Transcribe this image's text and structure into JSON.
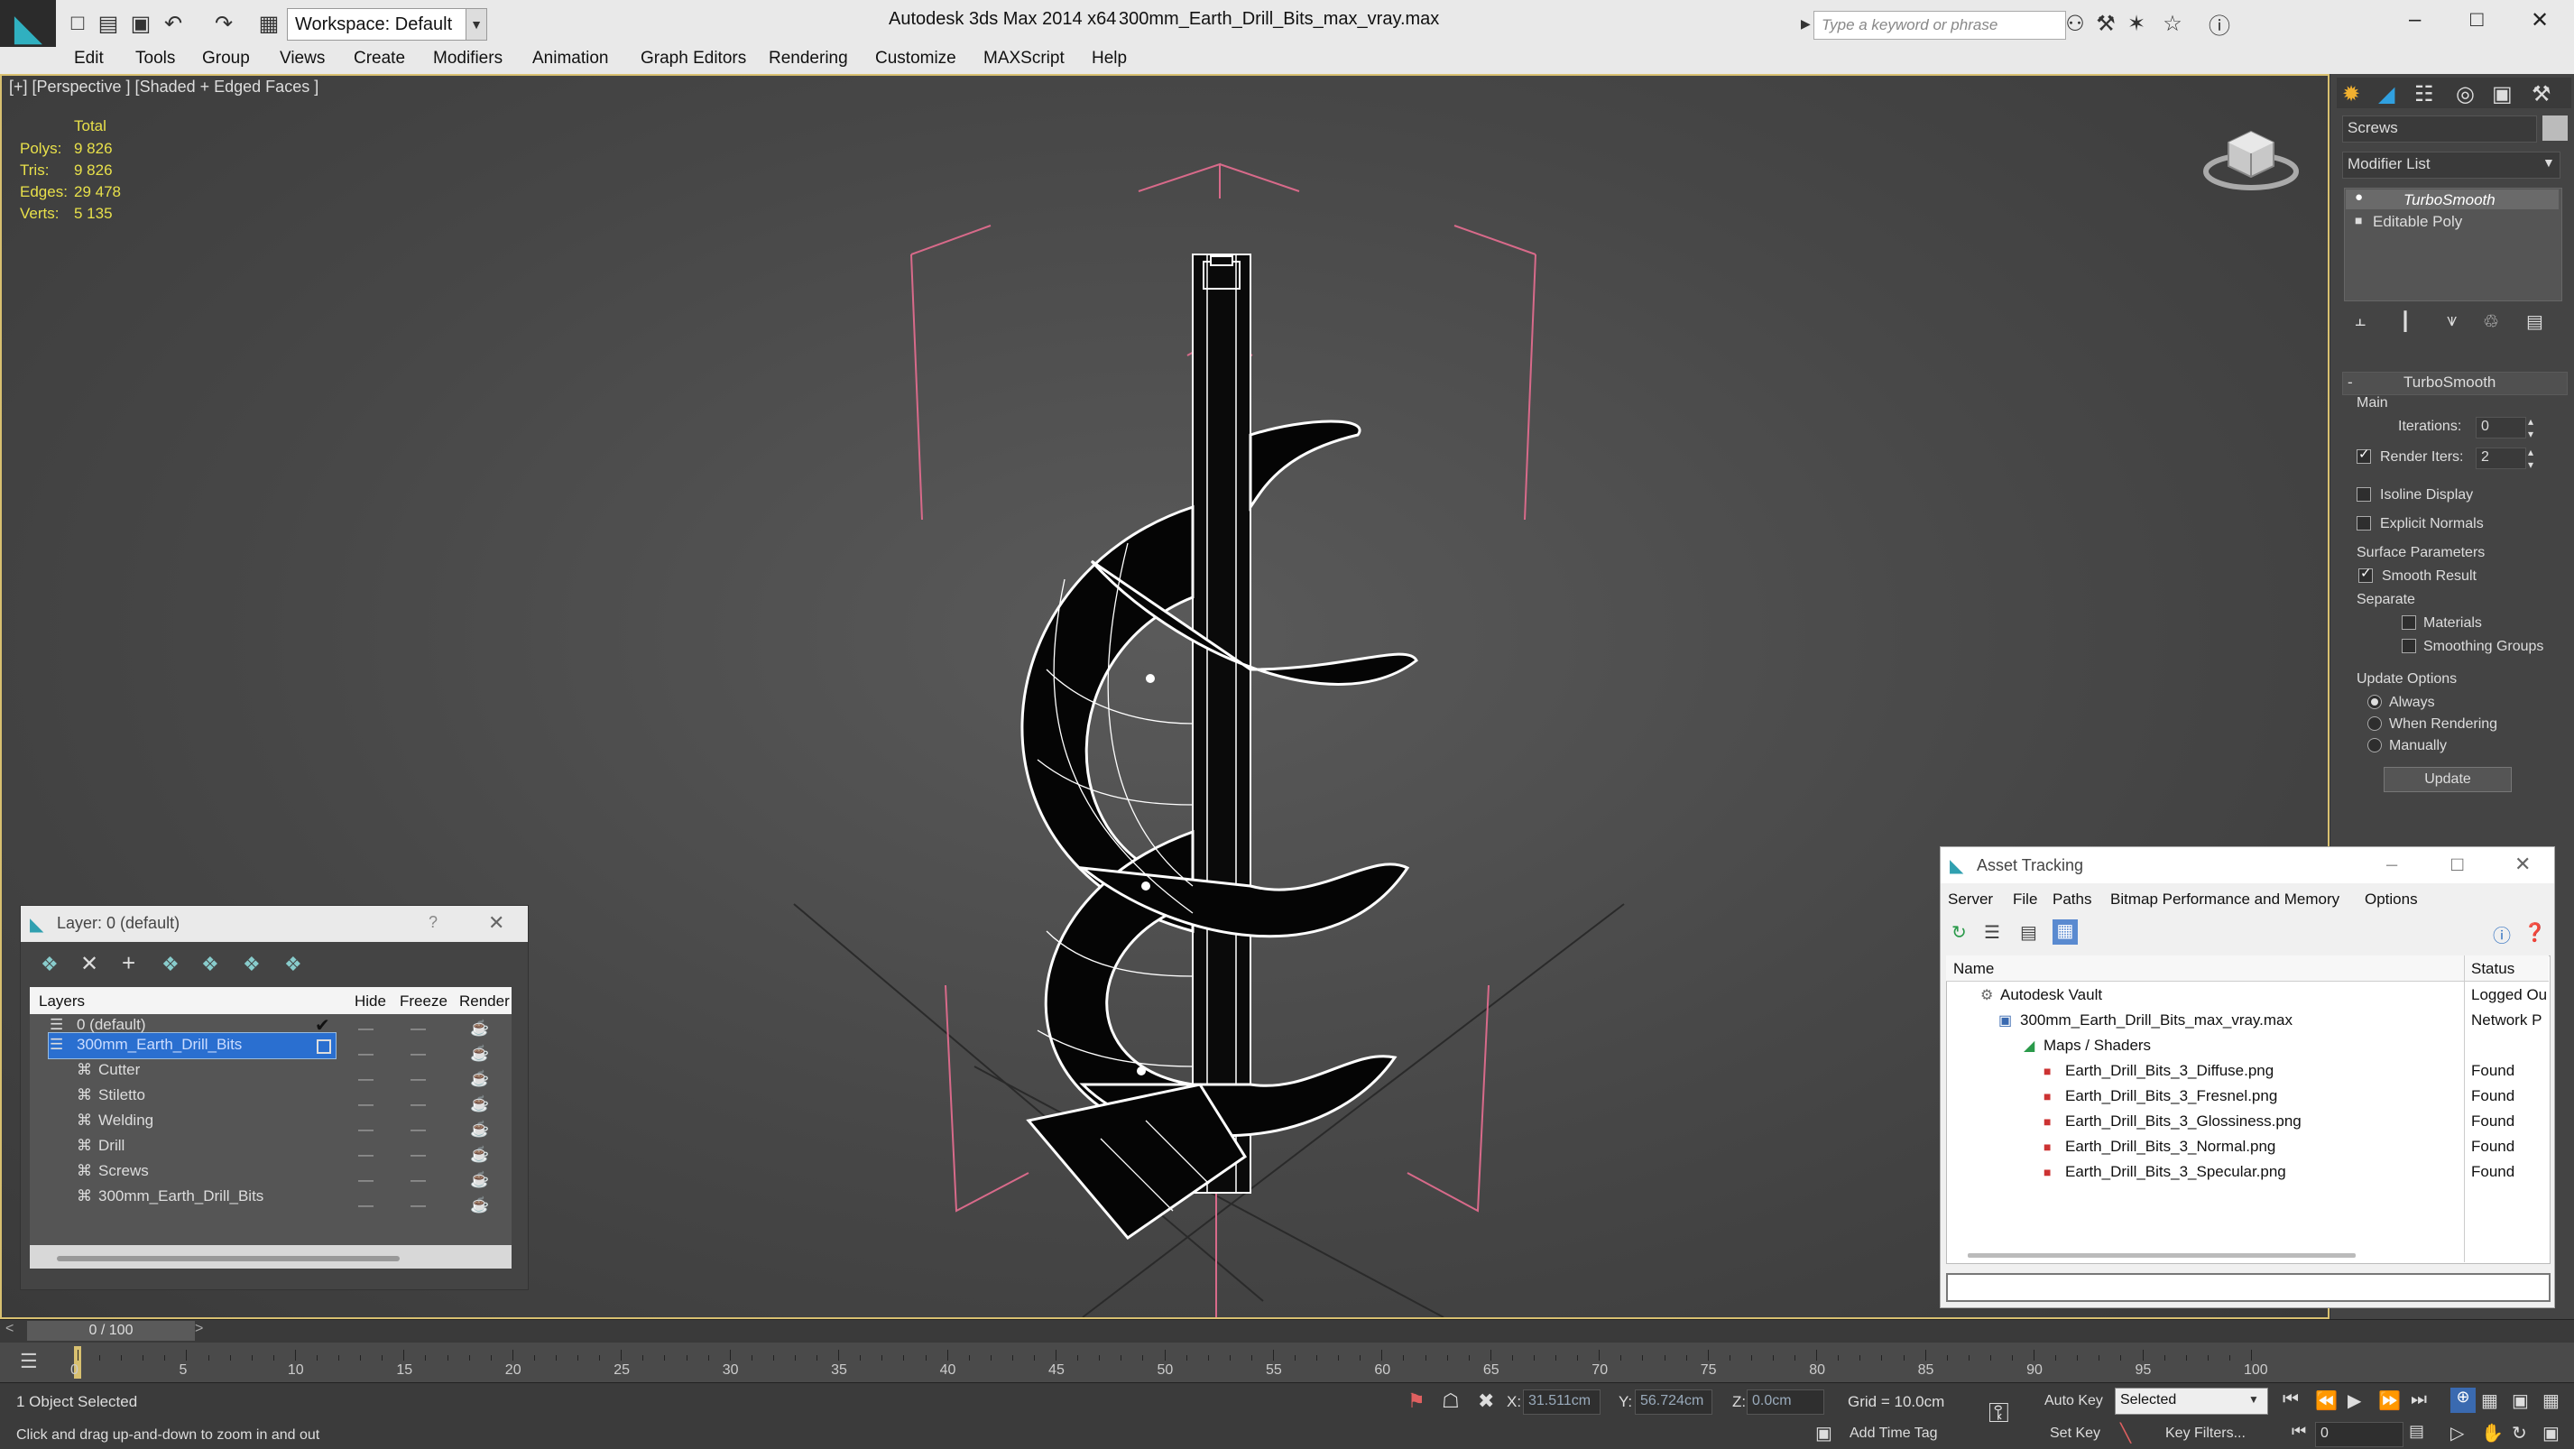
{
  "titlebar": {
    "workspace": "Workspace: Default",
    "app_title": "Autodesk 3ds Max  2014 x64",
    "file_title": "300mm_Earth_Drill_Bits_max_vray.max",
    "search_placeholder": "Type a keyword or phrase"
  },
  "menu": [
    "Edit",
    "Tools",
    "Group",
    "Views",
    "Create",
    "Modifiers",
    "Animation",
    "Graph Editors",
    "Rendering",
    "Customize",
    "MAXScript",
    "Help"
  ],
  "viewport": {
    "label": "[+] [Perspective ] [Shaded + Edged Faces ]",
    "stats": {
      "total_label": "Total",
      "polys_label": "Polys:",
      "polys": "9 826",
      "tris_label": "Tris:",
      "tris": "9 826",
      "edges_label": "Edges:",
      "edges": "29 478",
      "verts_label": "Verts:",
      "verts": "5 135"
    }
  },
  "command_panel": {
    "object_name": "Screws",
    "modifier_list": "Modifier List",
    "stack": [
      "TurboSmooth",
      "Editable Poly"
    ],
    "rollout_title": "TurboSmooth",
    "main_label": "Main",
    "iterations_label": "Iterations:",
    "iterations": "0",
    "render_iters_label": "Render Iters:",
    "render_iters": "2",
    "isoline": "Isoline Display",
    "explicit_normals": "Explicit Normals",
    "surface_params": "Surface Parameters",
    "smooth_result": "Smooth Result",
    "separate": "Separate",
    "materials": "Materials",
    "smoothing_groups": "Smoothing Groups",
    "update_options": "Update Options",
    "always": "Always",
    "when_rendering": "When Rendering",
    "manually": "Manually",
    "update_button": "Update"
  },
  "layer_dialog": {
    "title": "Layer: 0 (default)",
    "help": "?",
    "columns": [
      "Layers",
      "Hide",
      "Freeze",
      "Render"
    ],
    "rows": [
      "0 (default)",
      "300mm_Earth_Drill_Bits",
      "Cutter",
      "Stiletto",
      "Welding",
      "Drill",
      "Screws",
      "300mm_Earth_Drill_Bits"
    ]
  },
  "asset_tracking": {
    "title": "Asset Tracking",
    "menu": [
      "Server",
      "File",
      "Paths",
      "Bitmap Performance and Memory",
      "Options"
    ],
    "col_name": "Name",
    "col_status": "Status",
    "rows": [
      {
        "name": "Autodesk Vault",
        "status": "Logged Ou"
      },
      {
        "name": "300mm_Earth_Drill_Bits_max_vray.max",
        "status": "Network P"
      },
      {
        "name": "Maps / Shaders",
        "status": ""
      },
      {
        "name": "Earth_Drill_Bits_3_Diffuse.png",
        "status": "Found"
      },
      {
        "name": "Earth_Drill_Bits_3_Fresnel.png",
        "status": "Found"
      },
      {
        "name": "Earth_Drill_Bits_3_Glossiness.png",
        "status": "Found"
      },
      {
        "name": "Earth_Drill_Bits_3_Normal.png",
        "status": "Found"
      },
      {
        "name": "Earth_Drill_Bits_3_Specular.png",
        "status": "Found"
      }
    ]
  },
  "timeline": {
    "frame": "0 / 100",
    "ticks": [
      "0",
      "5",
      "10",
      "15",
      "20",
      "25",
      "30",
      "35",
      "40",
      "45",
      "50",
      "55",
      "60",
      "65",
      "70",
      "75",
      "80",
      "85",
      "90",
      "95",
      "100"
    ]
  },
  "status": {
    "selected": "1 Object Selected",
    "prompt": "Click and drag up-and-down to zoom in and out",
    "x_label": "X:",
    "x": "31.511cm",
    "y_label": "Y:",
    "y": "56.724cm",
    "z_label": "Z:",
    "z": "0.0cm",
    "grid": "Grid = 10.0cm",
    "add_time_tag": "Add Time Tag",
    "auto_key": "Auto Key",
    "set_key": "Set Key",
    "selected_dropdown": "Selected",
    "key_filters": "Key Filters...",
    "frame_field": "0"
  }
}
